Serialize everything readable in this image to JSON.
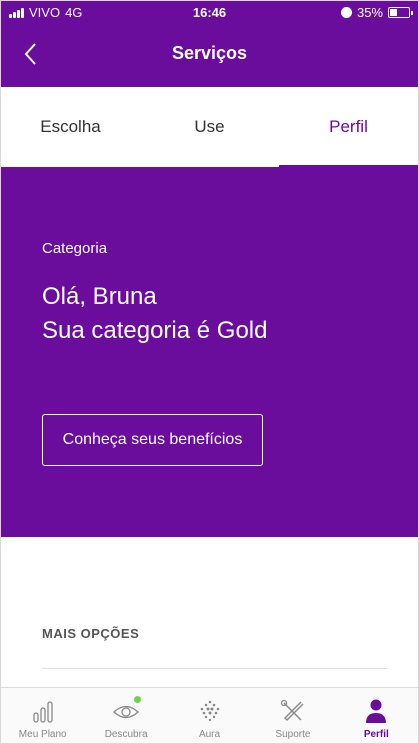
{
  "status_bar": {
    "carrier": "VIVO",
    "network": "4G",
    "time": "16:46",
    "battery": "35%",
    "battery_level": 0.35
  },
  "header": {
    "title": "Serviços",
    "back_icon": "chevron-left-icon"
  },
  "tabs": [
    {
      "label": "Escolha",
      "active": false
    },
    {
      "label": "Use",
      "active": false
    },
    {
      "label": "Perfil",
      "active": true
    }
  ],
  "hero": {
    "category_label": "Categoria",
    "greeting_line1": "Olá, Bruna",
    "greeting_line2": "Sua categoria é Gold",
    "benefits_button": "Conheça seus benefícios"
  },
  "more_options": {
    "heading": "MAIS OPÇÕES"
  },
  "tab_bar": [
    {
      "label": "Meu Plano",
      "icon": "bar-chart-icon",
      "active": false
    },
    {
      "label": "Descubra",
      "icon": "eye-icon",
      "active": false,
      "has_notification": true
    },
    {
      "label": "Aura",
      "icon": "dots-sphere-icon",
      "active": false
    },
    {
      "label": "Suporte",
      "icon": "tools-icon",
      "active": false
    },
    {
      "label": "Perfil",
      "icon": "person-icon",
      "active": true
    }
  ],
  "colors": {
    "brand_purple": "#6a0c9c",
    "notification_green": "#6bd44a",
    "inactive_gray": "#888888"
  }
}
